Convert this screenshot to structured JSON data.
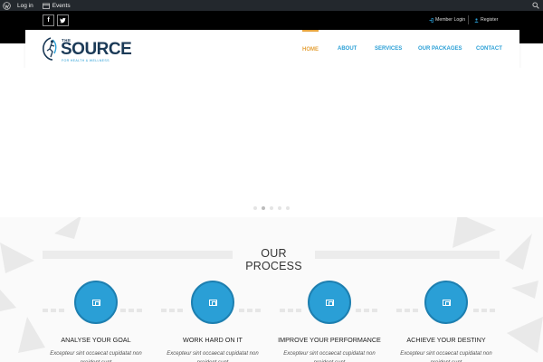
{
  "adminbar": {
    "items": [
      {
        "label": "Log in",
        "icon": "wordpress-icon"
      },
      {
        "label": "Events",
        "icon": "calendar-icon"
      }
    ],
    "search_icon": "search-icon"
  },
  "topbar": {
    "social": [
      {
        "label": "f",
        "icon": "facebook-icon"
      },
      {
        "label": "",
        "icon": "twitter-icon"
      }
    ],
    "links": [
      {
        "label": "Member Login",
        "icon": "sign-in-icon"
      },
      {
        "label": "Register",
        "icon": "user-icon"
      }
    ]
  },
  "logo": {
    "the": "THE",
    "source": "SOURCE",
    "tagline": "FOR HEALTH & WELLNESS"
  },
  "nav": {
    "items": [
      "HOME",
      "ABOUT",
      "SERVICES",
      "OUR PACKAGES",
      "CONTACT"
    ],
    "active": "HOME"
  },
  "slider": {
    "dots": 5,
    "active_dot": 2
  },
  "process": {
    "heading": "OUR PROCESS",
    "steps": [
      {
        "title": "ANALYSE YOUR GOAL",
        "text": "Excepteur sint  occaecat cupidatat non proident sunt"
      },
      {
        "title": "WORK HARD ON IT",
        "text": "Excepteur sint  occaecat cupidatat non proident sunt"
      },
      {
        "title": "IMPROVE YOUR PERFORMANCE",
        "text": "Excepteur sint  occaecat cupidatat non proident sunt"
      },
      {
        "title": "ACHIEVE YOUR DESTINY",
        "text": "Excepteur sint  occaecat cupidatat non proident sunt"
      }
    ]
  },
  "colors": {
    "accent_blue": "#2a9fd6",
    "active_orange": "#e5a33d",
    "adminbar": "#23282d",
    "topbar": "#000000"
  }
}
